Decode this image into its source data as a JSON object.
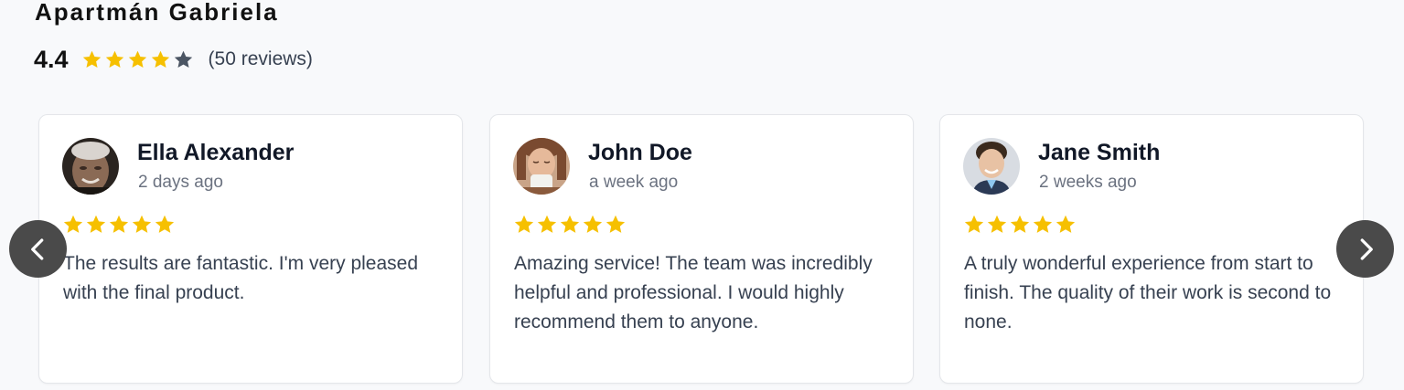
{
  "header": {
    "title": "Apartmán Gabriela",
    "rating_value": "4.4",
    "rating_score": 4.4,
    "rating_max": 5,
    "review_count": "(50 reviews)"
  },
  "colors": {
    "star_filled": "#f6c000",
    "star_empty": "#4b5563",
    "nav_button": "#4a4a4a"
  },
  "carousel": {
    "prev_icon": "chevron-left-icon",
    "next_icon": "chevron-right-icon"
  },
  "reviews": [
    {
      "author": "Ella Alexander",
      "time": "2 days ago",
      "stars": 5,
      "text": "The results are fantastic. I'm very pleased with the final product."
    },
    {
      "author": "John Doe",
      "time": "a week ago",
      "stars": 5,
      "text": "Amazing service! The team was incredibly helpful and professional. I would highly recommend them to anyone."
    },
    {
      "author": "Jane Smith",
      "time": "2 weeks ago",
      "stars": 5,
      "text": "A truly wonderful experience from start to finish. The quality of their work is second to none."
    }
  ]
}
